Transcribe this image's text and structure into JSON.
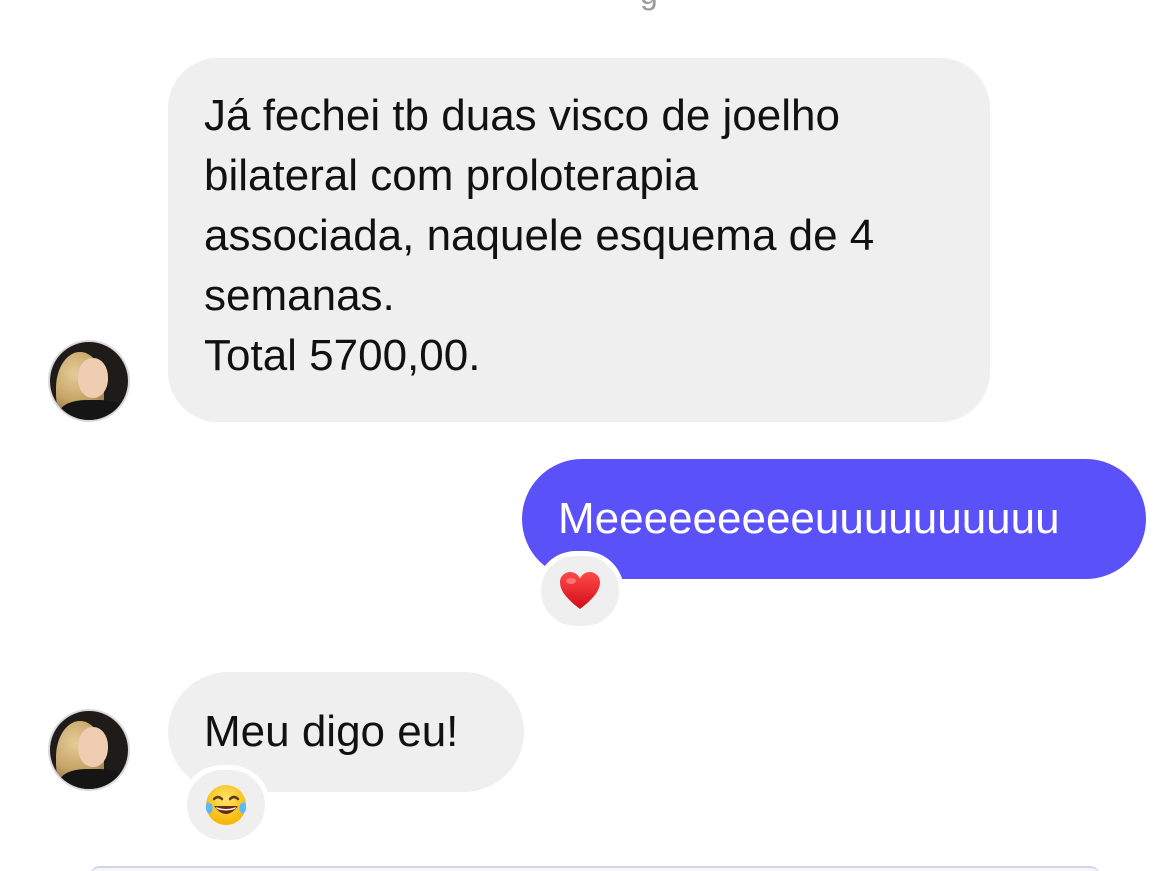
{
  "conversation": {
    "messages": [
      {
        "sender": "contact",
        "lines": [
          "Já fechei tb duas visco de joelho",
          "bilateral com proloterapia",
          "associada, naquele esquema de 4",
          "semanas.",
          "Total 5700,00."
        ]
      },
      {
        "sender": "me",
        "text": "Meeeeeeeeeuuuuuuuuuu",
        "reaction": "heart-icon"
      },
      {
        "sender": "contact",
        "text": "Meu digo eu!",
        "reaction": "laugh-icon"
      }
    ]
  },
  "colors": {
    "sent_bubble": "#5b51f9",
    "received_bubble": "#efefef",
    "reaction_bubble": "#efefef",
    "background": "#ffffff"
  }
}
